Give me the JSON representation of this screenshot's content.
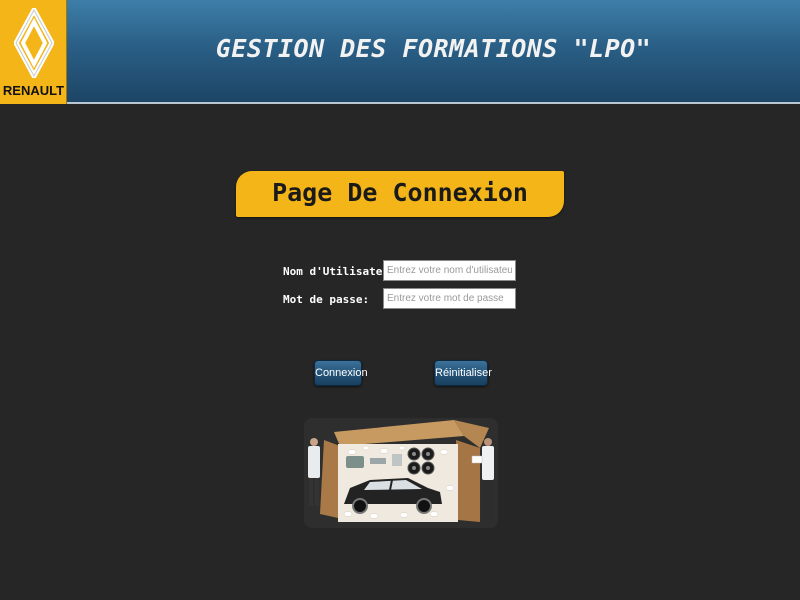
{
  "header": {
    "brand": "RENAULT",
    "title": "GESTION DES FORMATIONS \"LPO\""
  },
  "page": {
    "title": "Page De Connexion"
  },
  "form": {
    "username_label": "Nom d'Utilisateur:",
    "username_placeholder": "Entrez votre nom d'utilisateur",
    "username_value": "",
    "password_label": "Mot de passe:",
    "password_placeholder": "Entrez votre mot de passe",
    "password_value": ""
  },
  "buttons": {
    "connexion": "Connexion",
    "reset": "Réinitialiser"
  },
  "colors": {
    "accent_yellow": "#f3b517",
    "header_blue": "#2a5f86",
    "background": "#262626",
    "button_blue": "#245378"
  },
  "icons": {
    "logo": "renault-diamond-logo",
    "illustration": "car-in-box-illustration"
  }
}
